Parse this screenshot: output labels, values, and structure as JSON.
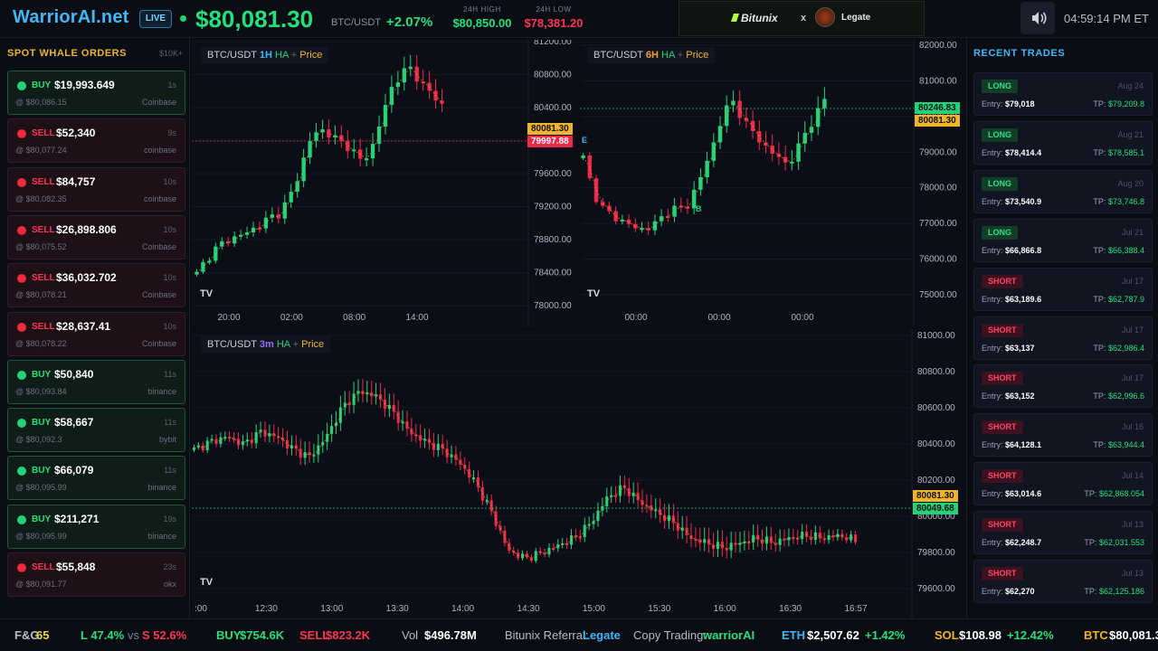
{
  "header": {
    "brand": "WarriorAI.net",
    "live": "LIVE",
    "price": "$80,081.30",
    "pair": "BTC/USDT",
    "change": "+2.07%",
    "high_label": "24H HIGH",
    "high_value": "$80,850.00",
    "low_label": "24H LOW",
    "low_value": "$78,381.20",
    "promo_brand": "Bitunix",
    "promo_x": "x",
    "promo_name": "Legate",
    "time": "04:59:14 PM ET",
    "colors": {
      "up": "#22e07a",
      "down": "#ff3550",
      "accent": "#3fb8f5"
    }
  },
  "whales": {
    "title": "SPOT WHALE ORDERS",
    "filter": "$10K+",
    "orders": [
      {
        "side": "BUY",
        "amount": "$19,993.649",
        "time": "1s",
        "at": "@ $80,086.15",
        "ex": "Coinbase"
      },
      {
        "side": "SELL",
        "amount": "$52,340",
        "time": "9s",
        "at": "@ $80,077.24",
        "ex": "coinbase"
      },
      {
        "side": "SELL",
        "amount": "$84,757",
        "time": "10s",
        "at": "@ $80,082.35",
        "ex": "coinbase"
      },
      {
        "side": "SELL",
        "amount": "$26,898.806",
        "time": "10s",
        "at": "@ $80,075.52",
        "ex": "Coinbase"
      },
      {
        "side": "SELL",
        "amount": "$36,032.702",
        "time": "10s",
        "at": "@ $80,078.21",
        "ex": "Coinbase"
      },
      {
        "side": "SELL",
        "amount": "$28,637.41",
        "time": "10s",
        "at": "@ $80,078.22",
        "ex": "Coinbase"
      },
      {
        "side": "BUY",
        "amount": "$50,840",
        "time": "11s",
        "at": "@ $80,093.84",
        "ex": "binance"
      },
      {
        "side": "BUY",
        "amount": "$58,667",
        "time": "11s",
        "at": "@ $80,092.3",
        "ex": "bybit"
      },
      {
        "side": "BUY",
        "amount": "$66,079",
        "time": "11s",
        "at": "@ $80,095.99",
        "ex": "binance"
      },
      {
        "side": "BUY",
        "amount": "$211,271",
        "time": "19s",
        "at": "@ $80,095.99",
        "ex": "binance"
      },
      {
        "side": "SELL",
        "amount": "$55,848",
        "time": "23s",
        "at": "@ $80,091.77",
        "ex": "okx"
      }
    ]
  },
  "trades": {
    "title": "RECENT TRADES",
    "entry_label": "Entry:",
    "tp_label": "TP:",
    "items": [
      {
        "type": "LONG",
        "date": "Aug 24",
        "entry": "$79,018",
        "tp": "$79,209.8"
      },
      {
        "type": "LONG",
        "date": "Aug 21",
        "entry": "$78,414.4",
        "tp": "$78,585.1"
      },
      {
        "type": "LONG",
        "date": "Aug 20",
        "entry": "$73,540.9",
        "tp": "$73,746.8"
      },
      {
        "type": "LONG",
        "date": "Jul 21",
        "entry": "$66,866.8",
        "tp": "$66,388.4"
      },
      {
        "type": "SHORT",
        "date": "Jul 17",
        "entry": "$63,189.6",
        "tp": "$62,787.9"
      },
      {
        "type": "SHORT",
        "date": "Jul 17",
        "entry": "$63,137",
        "tp": "$62,986.4"
      },
      {
        "type": "SHORT",
        "date": "Jul 17",
        "entry": "$63,152",
        "tp": "$62,996.6"
      },
      {
        "type": "SHORT",
        "date": "Jul 16",
        "entry": "$64,128.1",
        "tp": "$63,944.4"
      },
      {
        "type": "SHORT",
        "date": "Jul 14",
        "entry": "$63,014.6",
        "tp": "$62,868.054"
      },
      {
        "type": "SHORT",
        "date": "Jul 13",
        "entry": "$62,248.7",
        "tp": "$62,031.553"
      },
      {
        "type": "SHORT",
        "date": "Jul 13",
        "entry": "$62,270",
        "tp": "$62,125.186"
      }
    ]
  },
  "charts": {
    "c1h": {
      "pair": "BTC/USDT",
      "tf": "1H",
      "ha": "HA",
      "plus": "+",
      "price": "Price",
      "y_ticks": [
        "81200.00",
        "80800.00",
        "80400.00",
        "80000.00",
        "79600.00",
        "79200.00",
        "78800.00",
        "78400.00",
        "78000.00"
      ],
      "x_ticks": [
        "20:00",
        "02:00",
        "08:00",
        "14:00"
      ],
      "tag_price": "80081.30",
      "tag_line": "79997.88",
      "trend": [
        0.12,
        0.18,
        0.22,
        0.25,
        0.26,
        0.28,
        0.3,
        0.33,
        0.35,
        0.4,
        0.5,
        0.62,
        0.67,
        0.65,
        0.62,
        0.6,
        0.55,
        0.58,
        0.7,
        0.82,
        0.88,
        0.9,
        0.84,
        0.8,
        0.76
      ]
    },
    "c6h": {
      "pair": "BTC/USDT",
      "tf": "6H",
      "ha": "HA",
      "plus": "+",
      "price": "Price",
      "y_ticks": [
        "82000.00",
        "81000.00",
        "80000.00",
        "79000.00",
        "78000.00",
        "77000.00",
        "76000.00",
        "75000.00"
      ],
      "x_ticks": [
        "00:00",
        "00:00",
        "00:00"
      ],
      "tag_line": "80246.83",
      "tag_price": "80081.30",
      "marker_e": "E",
      "marker_b": "B",
      "trend": [
        0.55,
        0.42,
        0.35,
        0.32,
        0.3,
        0.28,
        0.26,
        0.27,
        0.29,
        0.33,
        0.35,
        0.34,
        0.42,
        0.5,
        0.6,
        0.72,
        0.78,
        0.72,
        0.66,
        0.62,
        0.58,
        0.55,
        0.52,
        0.58,
        0.65,
        0.72,
        0.78
      ]
    },
    "c3m": {
      "pair": "BTC/USDT",
      "tf": "3m",
      "ha": "HA",
      "plus": "+",
      "price": "Price",
      "y_ticks": [
        "81000.00",
        "80800.00",
        "80600.00",
        "80400.00",
        "80200.00",
        "80000.00",
        "79800.00",
        "79600.00"
      ],
      "x_ticks": [
        ":00",
        "12:30",
        "13:00",
        "13:30",
        "14:00",
        "14:30",
        "15:00",
        "15:30",
        "16:00",
        "16:30",
        "16:57"
      ],
      "tag_price": "80081.30",
      "tag_line": "80049.68",
      "trend": [
        0.55,
        0.58,
        0.6,
        0.57,
        0.62,
        0.6,
        0.55,
        0.52,
        0.6,
        0.72,
        0.78,
        0.76,
        0.7,
        0.62,
        0.58,
        0.55,
        0.5,
        0.42,
        0.3,
        0.15,
        0.12,
        0.14,
        0.17,
        0.2,
        0.26,
        0.36,
        0.4,
        0.34,
        0.3,
        0.26,
        0.2,
        0.18,
        0.16,
        0.18,
        0.2,
        0.18,
        0.2,
        0.21,
        0.2,
        0.21,
        0.19
      ]
    }
  },
  "ticker": [
    {
      "label": "F&G",
      "value": "65"
    },
    {
      "label": "L 47.4%",
      "vs": "vs",
      "value": "S 52.6%"
    },
    {
      "label": "BUY",
      "value": "$754.6K"
    },
    {
      "label": "SELL",
      "value": "$823.2K"
    },
    {
      "label": "Vol",
      "value": "$496.78M"
    },
    {
      "label": "Bitunix Referral:",
      "value": "Legate"
    },
    {
      "label": "Copy Trading:",
      "value": "warriorAI"
    },
    {
      "label": "ETH",
      "value": "$2,507.62",
      "chg": "+1.42%"
    },
    {
      "label": "SOL",
      "value": "$108.98",
      "chg": "+12.42%"
    },
    {
      "label": "BTC",
      "value": "$80,081.30"
    }
  ]
}
